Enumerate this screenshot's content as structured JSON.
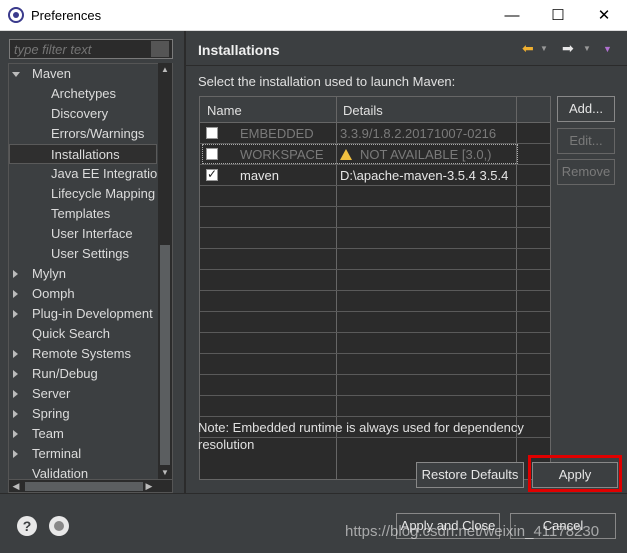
{
  "window": {
    "title": "Preferences",
    "minimize": "—",
    "maximize": "☐",
    "close": "✕"
  },
  "filter": {
    "placeholder": "type filter text"
  },
  "tree": {
    "items": [
      {
        "label": "Maven",
        "level": 0,
        "expander": "open"
      },
      {
        "label": "Archetypes",
        "level": 1
      },
      {
        "label": "Discovery",
        "level": 1
      },
      {
        "label": "Errors/Warnings",
        "level": 1
      },
      {
        "label": "Installations",
        "level": 1,
        "selected": true
      },
      {
        "label": "Java EE Integration",
        "level": 1
      },
      {
        "label": "Lifecycle Mapping",
        "level": 1
      },
      {
        "label": "Templates",
        "level": 1
      },
      {
        "label": "User Interface",
        "level": 1
      },
      {
        "label": "User Settings",
        "level": 1
      },
      {
        "label": "Mylyn",
        "level": 0,
        "expander": "closed"
      },
      {
        "label": "Oomph",
        "level": 0,
        "expander": "closed"
      },
      {
        "label": "Plug-in Development",
        "level": 0,
        "expander": "closed"
      },
      {
        "label": "Quick Search",
        "level": 0
      },
      {
        "label": "Remote Systems",
        "level": 0,
        "expander": "closed"
      },
      {
        "label": "Run/Debug",
        "level": 0,
        "expander": "closed"
      },
      {
        "label": "Server",
        "level": 0,
        "expander": "closed"
      },
      {
        "label": "Spring",
        "level": 0,
        "expander": "closed"
      },
      {
        "label": "Team",
        "level": 0,
        "expander": "closed"
      },
      {
        "label": "Terminal",
        "level": 0,
        "expander": "closed"
      },
      {
        "label": "Validation",
        "level": 0
      }
    ]
  },
  "page": {
    "title": "Installations",
    "back_icon": "back-arrow-icon",
    "forward_icon": "forward-arrow-icon",
    "prompt": "Select the installation used to launch Maven:",
    "columns": [
      "Name",
      "Details"
    ],
    "rows": [
      {
        "name": "EMBEDDED",
        "details": "3.3.9/1.8.2.20171007-0216",
        "checked": false,
        "disabled": true
      },
      {
        "name": "WORKSPACE",
        "details": "NOT AVAILABLE [3.0,)",
        "checked": false,
        "disabled": true,
        "warning": true
      },
      {
        "name": "maven",
        "details": "D:\\apache-maven-3.5.4 3.5.4",
        "checked": true,
        "disabled": false
      }
    ],
    "buttons": {
      "add": "Add...",
      "edit": "Edit...",
      "remove": "Remove"
    },
    "note": "Note: Embedded runtime is always used for dependency resolution",
    "restore_defaults": "Restore Defaults",
    "apply": "Apply",
    "highlight_color": "#e00000"
  },
  "footer": {
    "apply_and_close": "Apply and Close",
    "cancel": "Cancel",
    "watermark": "https://blog.csdn.net/weixin_41178230"
  }
}
